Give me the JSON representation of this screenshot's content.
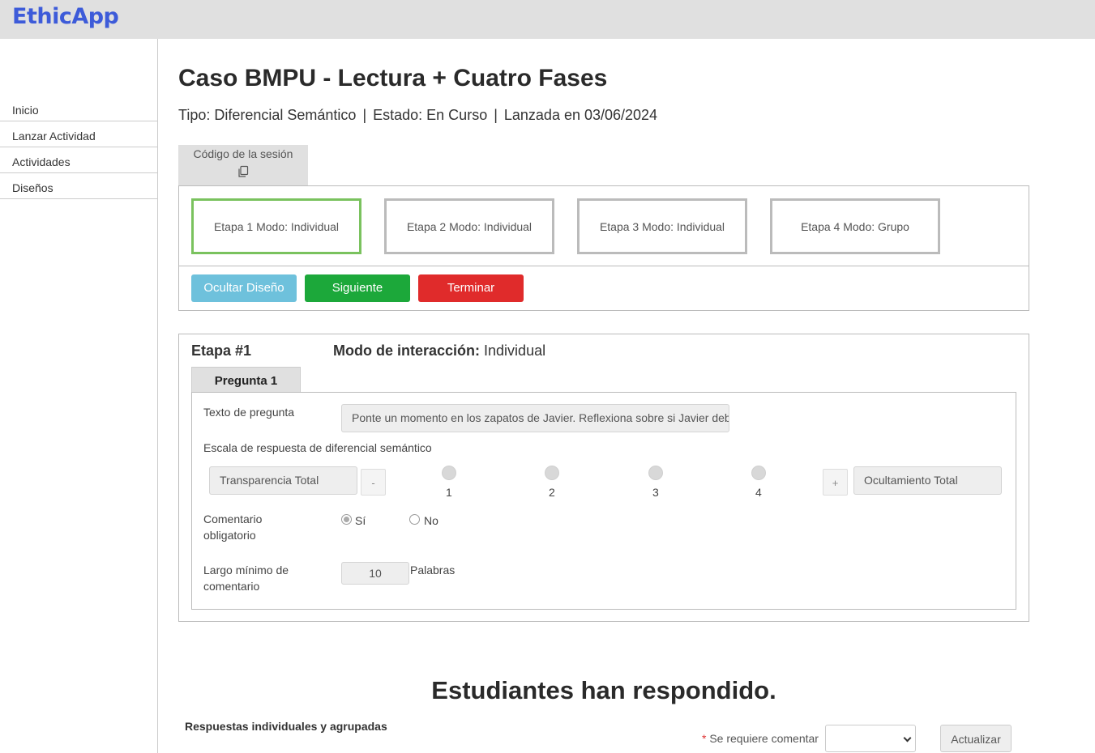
{
  "app": {
    "brand": "EthicApp"
  },
  "sidebar": {
    "items": [
      {
        "label": "Inicio"
      },
      {
        "label": "Lanzar Actividad"
      },
      {
        "label": "Actividades"
      },
      {
        "label": "Diseños"
      }
    ]
  },
  "header": {
    "title": "Caso BMPU - Lectura + Cuatro Fases",
    "tipo": "Tipo: Diferencial Semántico",
    "estado": "Estado: En Curso",
    "lanzada": "Lanzada en 03/06/2024",
    "separator": "|"
  },
  "session": {
    "code_label": "Código de la sesión",
    "copy_icon": "copy-icon"
  },
  "stages": [
    {
      "label": "Etapa 1 Modo: Individual",
      "active": true
    },
    {
      "label": "Etapa 2 Modo: Individual",
      "active": false
    },
    {
      "label": "Etapa 3 Modo: Individual",
      "active": false
    },
    {
      "label": "Etapa 4 Modo: Grupo",
      "active": false
    }
  ],
  "actions": {
    "hide_design": "Ocultar Diseño",
    "next": "Siguiente",
    "finish": "Terminar"
  },
  "colors": {
    "brand": "#3d5bd9",
    "active_stage": "#7ac25e",
    "hide_btn": "#6ec1dc",
    "next_btn": "#1ca83a",
    "finish_btn": "#e02b2b"
  },
  "stage_detail": {
    "number": "Etapa #1",
    "mode_label": "Modo de interacción:",
    "mode_value": "Individual",
    "tab": "Pregunta 1",
    "question_label": "Texto de pregunta",
    "question_value": "Ponte un momento en los zapatos de Javier. Reflexiona sobre si Javier debería",
    "scale_label": "Escala de respuesta de diferencial semántico",
    "left_pole": "Transparencia Total",
    "right_pole": "Ocultamiento Total",
    "minus": "-",
    "plus": "+",
    "scale_points": [
      "1",
      "2",
      "3",
      "4"
    ],
    "comment_label": "Comentario obligatorio",
    "comment_yes": "Sí",
    "comment_no": "No",
    "comment_selected": "Sí",
    "minlen_label": "Largo mínimo de comentario",
    "minlen_value": "10",
    "minlen_unit": "Palabras"
  },
  "responses": {
    "heading": "Estudiantes han respondido.",
    "subheading": "Respuestas individuales y agrupadas",
    "require_star": "*",
    "require_label": "Se requiere comentar",
    "select_value": "",
    "update": "Actualizar"
  }
}
